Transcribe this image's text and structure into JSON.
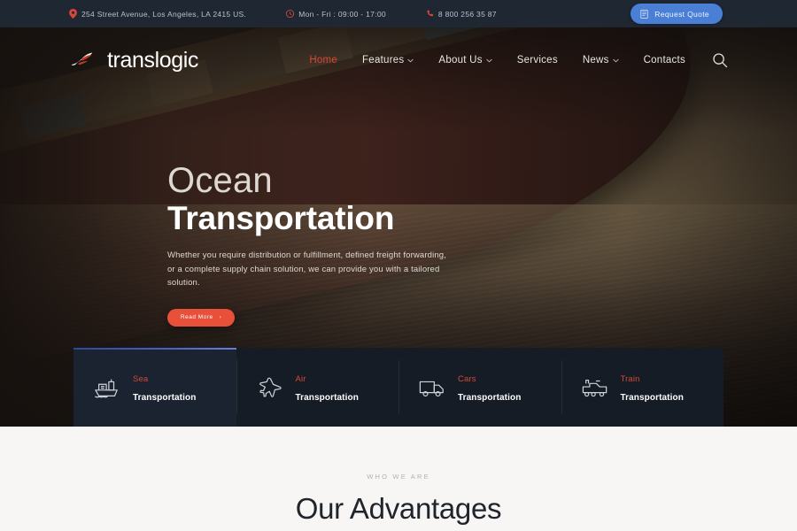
{
  "topbar": {
    "address": "254 Street Avenue, Los Angeles, LA 2415 US.",
    "hours": "Mon - Fri : 09:00 - 17:00",
    "phone": "8 800 256 35 87",
    "quote_label": "Request Quote",
    "icons": {
      "location": "map-pin-icon",
      "clock": "clock-icon",
      "phone": "phone-icon",
      "quote": "document-icon"
    },
    "bg": "#1f2733",
    "quote_bg": "#4a7fd6"
  },
  "header": {
    "logo_text": "translogic",
    "logo_mark": "swoosh-logo-icon",
    "search_icon": "search-icon",
    "nav": [
      {
        "label": "Home",
        "has_caret": false,
        "active": true
      },
      {
        "label": "Features",
        "has_caret": true,
        "active": false
      },
      {
        "label": "About Us",
        "has_caret": true,
        "active": false
      },
      {
        "label": "Services",
        "has_caret": false,
        "active": false
      },
      {
        "label": "News",
        "has_caret": true,
        "active": false
      },
      {
        "label": "Contacts",
        "has_caret": false,
        "active": false
      }
    ]
  },
  "hero": {
    "title_light": "Ocean",
    "title_bold": "Transportation",
    "subtitle": "Whether you require distribution or fulfillment, defined freight forwarding, or a complete supply chain solution, we can provide you with a tailored solution.",
    "cta_label": "Read More",
    "cta_arrow": "›",
    "accent": "#e8503a",
    "slides": {
      "count": 4,
      "active_index": 0
    }
  },
  "services": [
    {
      "kind": "Sea",
      "word": "Transportation",
      "icon": "ship-icon",
      "active": true
    },
    {
      "kind": "Air",
      "word": "Transportation",
      "icon": "airplane-icon",
      "active": false
    },
    {
      "kind": "Cars",
      "word": "Transportation",
      "icon": "truck-icon",
      "active": false
    },
    {
      "kind": "Train",
      "word": "Transportation",
      "icon": "locomotive-icon",
      "active": false
    }
  ],
  "advantages": {
    "eyebrow": "WHO WE ARE",
    "title": "Our Advantages",
    "bg": "#f7f6f4"
  }
}
